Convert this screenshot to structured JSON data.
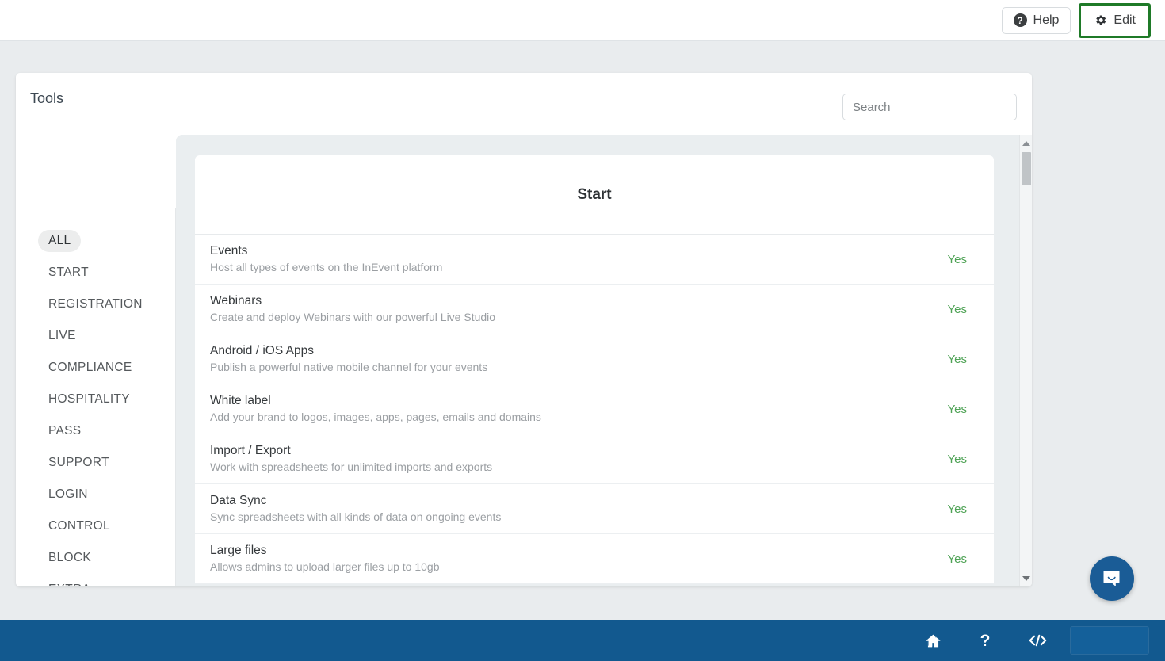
{
  "topbar": {
    "help_label": "Help",
    "help_icon": "question-circle-icon",
    "edit_label": "Edit",
    "edit_icon": "gear-icon",
    "highlight_color": "#1f7a28"
  },
  "card": {
    "title": "Tools",
    "search": {
      "placeholder": "Search",
      "value": ""
    }
  },
  "categories": [
    {
      "label": "ALL",
      "active": true
    },
    {
      "label": "START",
      "active": false
    },
    {
      "label": "REGISTRATION",
      "active": false
    },
    {
      "label": "LIVE",
      "active": false
    },
    {
      "label": "COMPLIANCE",
      "active": false
    },
    {
      "label": "HOSPITALITY",
      "active": false
    },
    {
      "label": "PASS",
      "active": false
    },
    {
      "label": "SUPPORT",
      "active": false
    },
    {
      "label": "LOGIN",
      "active": false
    },
    {
      "label": "CONTROL",
      "active": false
    },
    {
      "label": "BLOCK",
      "active": false
    },
    {
      "label": "EXTRA",
      "active": false
    }
  ],
  "tools_panel": {
    "section_title": "Start",
    "value_color": "#4fa356",
    "rows": [
      {
        "name": "Events",
        "desc": "Host all types of events on the InEvent platform",
        "value": "Yes"
      },
      {
        "name": "Webinars",
        "desc": "Create and deploy Webinars with our powerful Live Studio",
        "value": "Yes"
      },
      {
        "name": "Android / iOS Apps",
        "desc": "Publish a powerful native mobile channel for your events",
        "value": "Yes"
      },
      {
        "name": "White label",
        "desc": "Add your brand to logos, images, apps, pages, emails and domains",
        "value": "Yes"
      },
      {
        "name": "Import / Export",
        "desc": "Work with spreadsheets for unlimited imports and exports",
        "value": "Yes"
      },
      {
        "name": "Data Sync",
        "desc": "Sync spreadsheets with all kinds of data on ongoing events",
        "value": "Yes"
      },
      {
        "name": "Large files",
        "desc": "Allows admins to upload larger files up to 10gb",
        "value": "Yes"
      }
    ],
    "scrollbar": {
      "up_icon": "chevron-up-icon",
      "down_icon": "chevron-down-icon"
    }
  },
  "intercom": {
    "icon": "chat-bubble-icon",
    "color": "#1a5c96"
  },
  "bottombar": {
    "color": "#12598f",
    "items": [
      {
        "icon": "home-icon",
        "glyph": "home"
      },
      {
        "icon": "question-mark-icon",
        "glyph": "?"
      },
      {
        "icon": "code-icon",
        "glyph": "code"
      }
    ]
  }
}
